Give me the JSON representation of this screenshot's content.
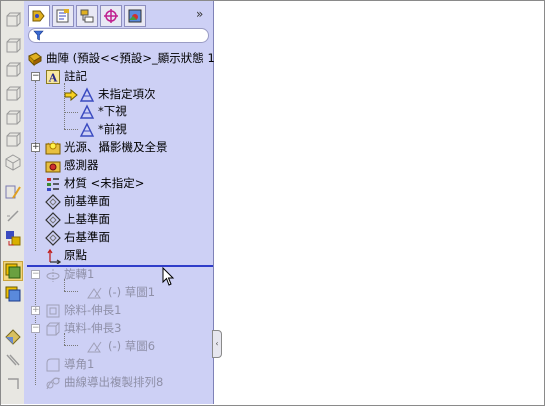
{
  "panel": {
    "more_glyph": "»",
    "tabs": [
      {
        "name": "featuremanager-tab",
        "icon": "feature-tree-icon",
        "selected": true
      },
      {
        "name": "propertymanager-tab",
        "icon": "property-icon",
        "selected": false
      },
      {
        "name": "configurationmanager-tab",
        "icon": "configuration-icon",
        "selected": false
      },
      {
        "name": "dimxpert-tab",
        "icon": "crosshair-icon",
        "selected": false
      },
      {
        "name": "display-manager-tab",
        "icon": "display-icon",
        "selected": false
      }
    ],
    "filter_placeholder": ""
  },
  "tree": {
    "root": "曲陣 (預設<<預設>_顯示狀態 1",
    "annotations": "註記",
    "unassigned": "未指定項次",
    "bottom_view": "*下視",
    "front_view": "*前視",
    "lights": "光源、攝影機及全景",
    "sensors": "感測器",
    "material": "材質 <未指定>",
    "front_plane": "前基準面",
    "top_plane": "上基準面",
    "right_plane": "右基準面",
    "origin": "原點",
    "revolve": "旋轉1",
    "sketch1": "(-) 草圖1",
    "cut_extrude": "除料-伸長1",
    "boss_extrude": "填料-伸長3",
    "sketch6": "(-) 草圖6",
    "fillet": "導角1",
    "curve_pattern": "曲線導出複製排列8"
  },
  "colors": {
    "panel_bg": "#cdd0f5",
    "rollback_bar": "#2f3cc9",
    "suppressed_text": "#8f90a8"
  }
}
